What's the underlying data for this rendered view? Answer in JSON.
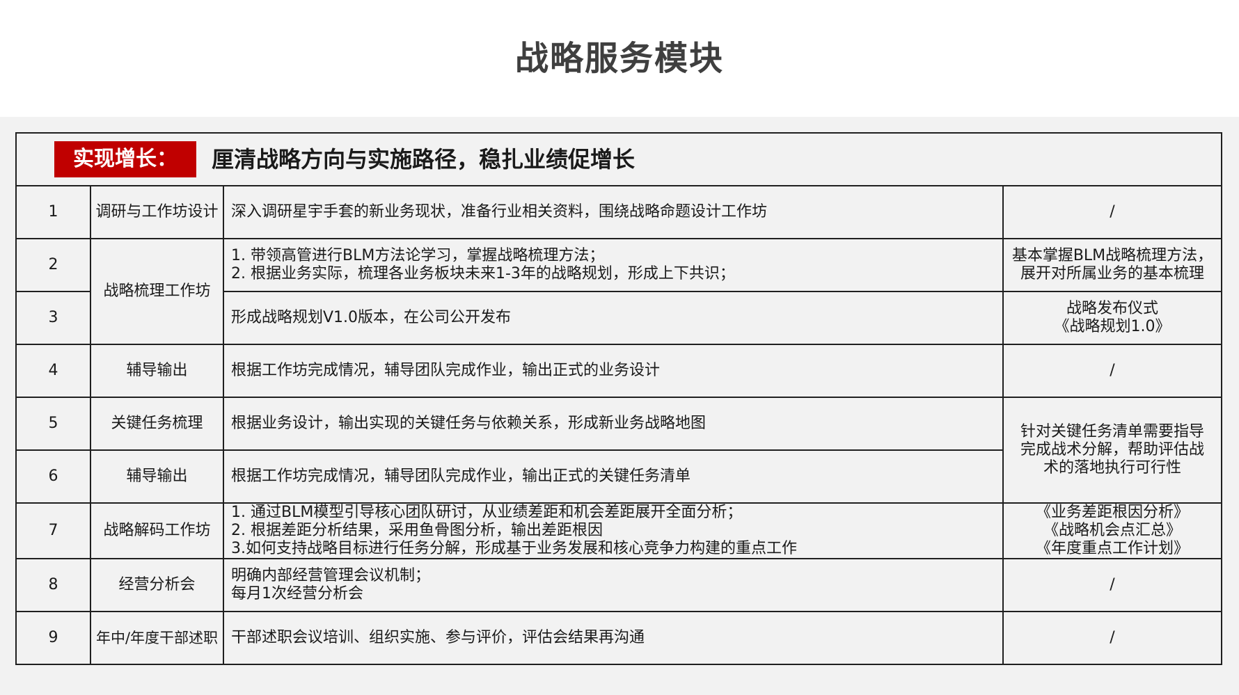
{
  "page_title": "战略服务模块",
  "header": {
    "tag": "实现增长：",
    "text": "厘清战略方向与实施路径，稳扎业绩促增长"
  },
  "rows": [
    {
      "num": "1",
      "name": "调研与工作坊设计",
      "desc": [
        "深入调研星宇手套的新业务现状，准备行业相关资料，围绕战略命题设计工作坊"
      ],
      "output": [
        "/"
      ]
    },
    {
      "num": "2",
      "name": "战略梳理工作坊",
      "desc": [
        "1. 带领高管进行BLM方法论学习，掌握战略梳理方法；",
        "2. 根据业务实际，梳理各业务板块未来1-3年的战略规划，形成上下共识；"
      ],
      "output": [
        "基本掌握BLM战略梳理方法，",
        "展开对所属业务的基本梳理"
      ]
    },
    {
      "num": "3",
      "desc": [
        "形成战略规划V1.0版本，在公司公开发布"
      ],
      "output": [
        "战略发布仪式",
        "《战略规划1.0》"
      ]
    },
    {
      "num": "4",
      "name": "辅导输出",
      "desc": [
        "根据工作坊完成情况，辅导团队完成作业，输出正式的业务设计"
      ],
      "output": [
        "/"
      ]
    },
    {
      "num": "5",
      "name": "关键任务梳理",
      "desc": [
        "根据业务设计，输出实现的关键任务与依赖关系，形成新业务战略地图"
      ],
      "output": [
        "针对关键任务清单需要指导",
        "完成战术分解，帮助评估战",
        "术的落地执行可行性"
      ]
    },
    {
      "num": "6",
      "name": "辅导输出",
      "desc": [
        "根据工作坊完成情况，辅导团队完成作业，输出正式的关键任务清单"
      ]
    },
    {
      "num": "7",
      "name": "战略解码工作坊",
      "desc": [
        "1. 通过BLM模型引导核心团队研讨，从业绩差距和机会差距展开全面分析；",
        "2. 根据差距分析结果，采用鱼骨图分析，输出差距根因",
        "3.如何支持战略目标进行任务分解，形成基于业务发展和核心竞争力构建的重点工作"
      ],
      "output": [
        "《业务差距根因分析》",
        "《战略机会点汇总》",
        "《年度重点工作计划》"
      ]
    },
    {
      "num": "8",
      "name": "经营分析会",
      "desc": [
        "明确内部经营管理会议机制；",
        "每月1次经营分析会"
      ],
      "output": [
        "/"
      ]
    },
    {
      "num": "9",
      "name": "年中/年度干部述职",
      "desc": [
        "干部述职会议培训、组织实施、参与评价，评估会结果再沟通"
      ],
      "output": [
        "/"
      ]
    }
  ]
}
